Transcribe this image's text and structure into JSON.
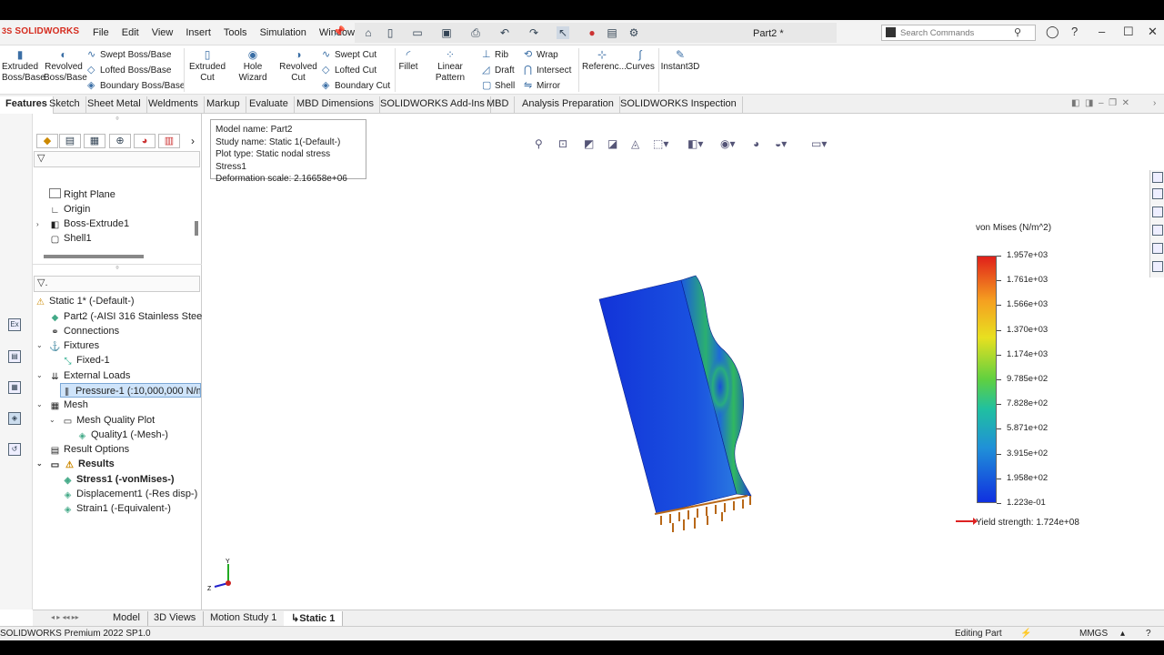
{
  "app": {
    "logo": "SOLIDWORKS",
    "document_title": "Part2 *"
  },
  "menu": [
    "File",
    "Edit",
    "View",
    "Insert",
    "Tools",
    "Simulation",
    "Window"
  ],
  "search": {
    "placeholder": "Search Commands"
  },
  "command_manager": {
    "extruded_boss": "Extruded\nBoss/Base",
    "revolved_boss": "Revolved\nBoss/Base",
    "swept_boss": "Swept Boss/Base",
    "lofted_boss": "Lofted Boss/Base",
    "boundary_boss": "Boundary Boss/Base",
    "extruded_cut": "Extruded\nCut",
    "hole_wizard": "Hole Wizard",
    "revolved_cut": "Revolved\nCut",
    "swept_cut": "Swept Cut",
    "lofted_cut": "Lofted Cut",
    "boundary_cut": "Boundary Cut",
    "fillet": "Fillet",
    "linear_pattern": "Linear Pattern",
    "rib": "Rib",
    "draft": "Draft",
    "shell": "Shell",
    "wrap": "Wrap",
    "intersect": "Intersect",
    "mirror": "Mirror",
    "reference": "Referenc...",
    "curves": "Curves",
    "instant3d": "Instant3D"
  },
  "tabs": [
    "Features",
    "Sketch",
    "Sheet Metal",
    "Weldments",
    "Markup",
    "Evaluate",
    "MBD Dimensions",
    "SOLIDWORKS Add-Ins",
    "MBD",
    "Analysis Preparation",
    "SOLIDWORKS Inspection"
  ],
  "feature_tree": {
    "items": [
      "Right Plane",
      "Origin",
      "Boss-Extrude1",
      "Shell1"
    ]
  },
  "sim_tree": {
    "study": "Static 1* (-Default-)",
    "part": "Part2 (-AISI 316 Stainless Steel-)",
    "connections": "Connections",
    "fixtures": "Fixtures",
    "fixed": "Fixed-1",
    "external_loads": "External Loads",
    "pressure": "Pressure-1 (:10,000,000 N/m^2:)",
    "mesh": "Mesh",
    "mesh_quality_plot": "Mesh Quality Plot",
    "quality1": "Quality1 (-Mesh-)",
    "result_options": "Result Options",
    "results": "Results",
    "stress1": "Stress1 (-vonMises-)",
    "displacement1": "Displacement1 (-Res disp-)",
    "strain1": "Strain1 (-Equivalent-)"
  },
  "info_box": {
    "model_name": "Model name: Part2",
    "study_name": "Study name: Static 1(-Default-)",
    "plot_type": "Plot type: Static nodal stress Stress1",
    "deformation_scale": "Deformation scale: 2.16658e+06"
  },
  "legend": {
    "title": "von Mises (N/m^2)",
    "labels": [
      "1.957e+03",
      "1.761e+03",
      "1.566e+03",
      "1.370e+03",
      "1.174e+03",
      "9.785e+02",
      "7.828e+02",
      "5.871e+02",
      "3.915e+02",
      "1.958e+02",
      "1.223e-01"
    ],
    "yield": "Yield strength: 1.724e+08"
  },
  "triad": {
    "x": "X",
    "y": "Y",
    "z": "Z"
  },
  "bottom_tabs": [
    "Model",
    "3D Views",
    "Motion Study 1",
    "Static 1"
  ],
  "status": {
    "product": "SOLIDWORKS Premium 2022 SP1.0",
    "mode": "Editing Part",
    "units": "MMGS"
  }
}
